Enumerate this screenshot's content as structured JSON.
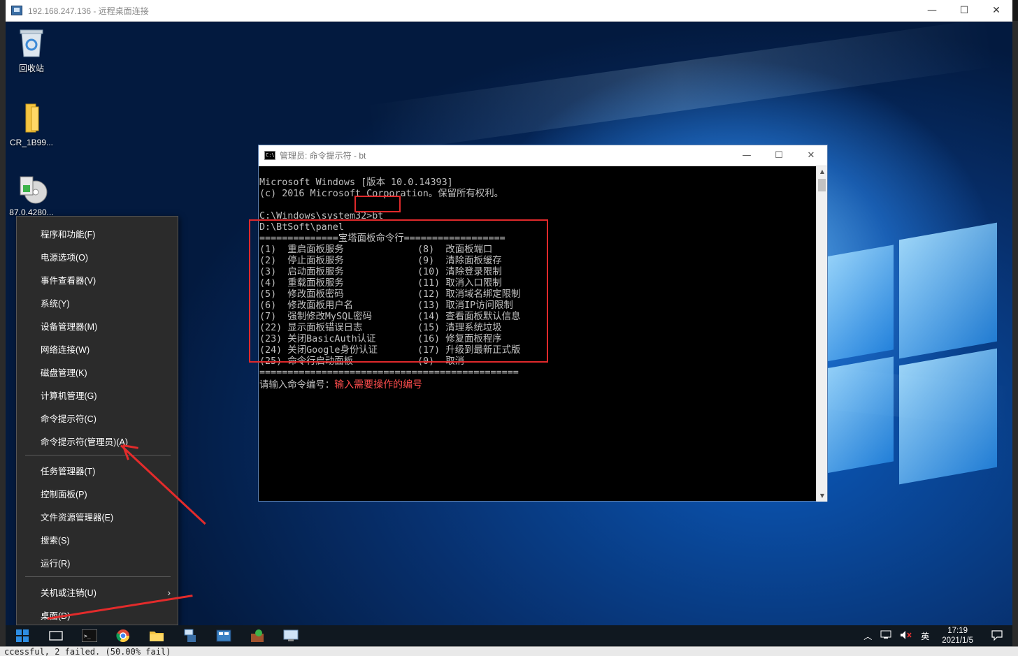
{
  "rdp": {
    "title": "192.168.247.136 - 远程桌面连接",
    "minimize_glyph": "—",
    "maximize_glyph": "☐",
    "close_glyph": "✕"
  },
  "desktop_icons": [
    {
      "label": "回收站",
      "icon": "recycle-bin-icon"
    },
    {
      "label": "CR_1B99...",
      "icon": "folder-icon"
    },
    {
      "label": "87.0.4280...",
      "icon": "installer-icon"
    }
  ],
  "cmd": {
    "title": "管理员: 命令提示符 - bt",
    "header_line1": "Microsoft Windows [版本 10.0.14393]",
    "header_line2": "(c) 2016 Microsoft Corporation。保留所有权利。",
    "prompt_path": "C:\\Windows\\system32>",
    "prompt_cmd": "bt",
    "panel_path": "D:\\BtSoft\\panel",
    "banner": "==============宝塔面板命令行==================",
    "menu": [
      {
        "left": "(1)  重启面板服务",
        "right": "(8)  改面板端口"
      },
      {
        "left": "(2)  停止面板服务",
        "right": "(9)  清除面板缓存"
      },
      {
        "left": "(3)  启动面板服务",
        "right": "(10) 清除登录限制"
      },
      {
        "left": "(4)  重载面板服务",
        "right": "(11) 取消入口限制"
      },
      {
        "left": "(5)  修改面板密码",
        "right": "(12) 取消域名绑定限制"
      },
      {
        "left": "(6)  修改面板用户名",
        "right": "(13) 取消IP访问限制"
      },
      {
        "left": "(7)  强制修改MySQL密码",
        "right": "(14) 查看面板默认信息"
      },
      {
        "left": "(22) 显示面板错误日志",
        "right": "(15) 清理系统垃圾"
      },
      {
        "left": "(23) 关闭BasicAuth认证",
        "right": "(16) 修复面板程序"
      },
      {
        "left": "(24) 关闭Google身份认证",
        "right": "(17) 升级到最新正式版"
      },
      {
        "left": "(25) 命令行启动面板",
        "right": "(0)  取消"
      }
    ],
    "footer_rule": "==============================================",
    "input_prompt": "请输入命令编号：",
    "annotation": "输入需要操作的编号"
  },
  "winx_menu": {
    "items": [
      "程序和功能(F)",
      "电源选项(O)",
      "事件查看器(V)",
      "系统(Y)",
      "设备管理器(M)",
      "网络连接(W)",
      "磁盘管理(K)",
      "计算机管理(G)",
      "命令提示符(C)",
      "命令提示符(管理员)(A)",
      "任务管理器(T)",
      "控制面板(P)",
      "文件资源管理器(E)",
      "搜索(S)",
      "运行(R)",
      "关机或注销(U)",
      "桌面(D)"
    ],
    "submenu_glyph": "›"
  },
  "taskbar": {
    "ime": "英",
    "time": "17:19",
    "date": "2021/1/5"
  },
  "host_bottom_text": "ccessful, 2 failed. (50.00% fail)",
  "colors": {
    "annotation_red": "#e0292b",
    "cmd_text": "#c0c0c0",
    "menu_bg": "#2b2b2b"
  }
}
